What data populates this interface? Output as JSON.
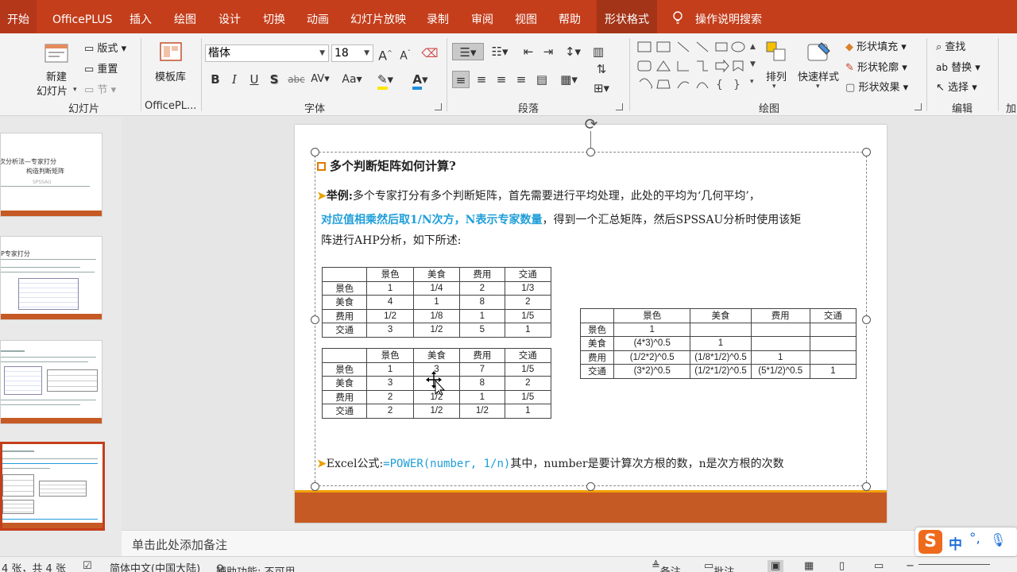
{
  "tabs": {
    "home": "开始",
    "officeplus": "OfficePLUS",
    "insert": "插入",
    "draw": "绘图",
    "design": "设计",
    "transitions": "切换",
    "animations": "动画",
    "slideshow": "幻灯片放映",
    "record": "录制",
    "review": "审阅",
    "view": "视图",
    "help": "帮助",
    "shape_format": "形状格式",
    "tell_me": "操作说明搜索"
  },
  "ribbon": {
    "slides": {
      "new_slide_l1": "新建",
      "new_slide_l2": "幻灯片",
      "layout": "版式",
      "reset": "重置",
      "section": "节",
      "label": "幻灯片"
    },
    "officeplus": {
      "template": "模板库",
      "label": "OfficePL..."
    },
    "font": {
      "name": "楷体",
      "size": "18",
      "grow": "A",
      "shrink": "A",
      "bold": "B",
      "italic": "I",
      "underline": "U",
      "shadow": "S",
      "strike": "abc",
      "spacing": "AV",
      "case": "Aa",
      "label": "字体"
    },
    "paragraph": {
      "label": "段落"
    },
    "drawing": {
      "arrange": "排列",
      "quick_styles": "快速样式",
      "fill": "形状填充",
      "outline": "形状轮廓",
      "effects": "形状效果",
      "label": "绘图"
    },
    "editing": {
      "find": "查找",
      "replace": "替换",
      "select": "选择",
      "label": "编辑",
      "cut": "加"
    }
  },
  "thumbnails": {
    "slide1_l1": "次分析法—专家打分",
    "slide1_l2": "构造判断矩阵",
    "slide1_sub": "SPSSAU",
    "slide2_title": "P专家打分"
  },
  "slide": {
    "heading": "多个判断矩阵如何计算?",
    "p1_label": "举例:",
    "p1_text": "多个专家打分有多个判断矩阵，首先需要进行平均处理，此处的平均为‘几何平均’，",
    "p2_blue": "对应值相乘然后取1/N次方，N表示专家数量",
    "p2_text": "，得到一个汇总矩阵，然后SPSSAU分析时使用该矩",
    "p3_text": "阵进行AHP分析，如下所述:",
    "excel_label": "Excel公式:",
    "excel_formula": "=POWER(number, 1/n)",
    "excel_text": "其中，number是要计算次方根的数，n是次方根的次数",
    "table1": {
      "header": [
        "",
        "景色",
        "美食",
        "费用",
        "交通"
      ],
      "rows": [
        [
          "景色",
          "1",
          "1/4",
          "2",
          "1/3"
        ],
        [
          "美食",
          "4",
          "1",
          "8",
          "2"
        ],
        [
          "费用",
          "1/2",
          "1/8",
          "1",
          "1/5"
        ],
        [
          "交通",
          "3",
          "1/2",
          "5",
          "1"
        ]
      ]
    },
    "table2": {
      "header": [
        "",
        "景色",
        "美食",
        "费用",
        "交通"
      ],
      "rows": [
        [
          "景色",
          "1",
          "3",
          "7",
          "1/5"
        ],
        [
          "美食",
          "3",
          "",
          "8",
          "2"
        ],
        [
          "费用",
          "2",
          "1/2",
          "1",
          "1/5"
        ],
        [
          "交通",
          "2",
          "1/2",
          "1/2",
          "1"
        ]
      ]
    },
    "table3": {
      "header": [
        "",
        "景色",
        "美食",
        "费用",
        "交通"
      ],
      "rows": [
        [
          "景色",
          "1",
          "",
          "",
          ""
        ],
        [
          "美食",
          "(4*3)^0.5",
          "1",
          "",
          ""
        ],
        [
          "费用",
          "(1/2*2)^0.5",
          "(1/8*1/2)^0.5",
          "1",
          ""
        ],
        [
          "交通",
          "(3*2)^0.5",
          "(1/2*1/2)^0.5",
          "(5*1/2)^0.5",
          "1"
        ]
      ]
    }
  },
  "notes_placeholder": "单击此处添加备注",
  "status": {
    "slide_count": "4 张，共 4 张",
    "language": "简体中文(中国大陆)",
    "accessibility": "辅助功能: 不可用",
    "notes": "备注",
    "comments": "批注"
  },
  "ime": {
    "logo": "S",
    "mode": "中",
    "punct": "°,"
  }
}
